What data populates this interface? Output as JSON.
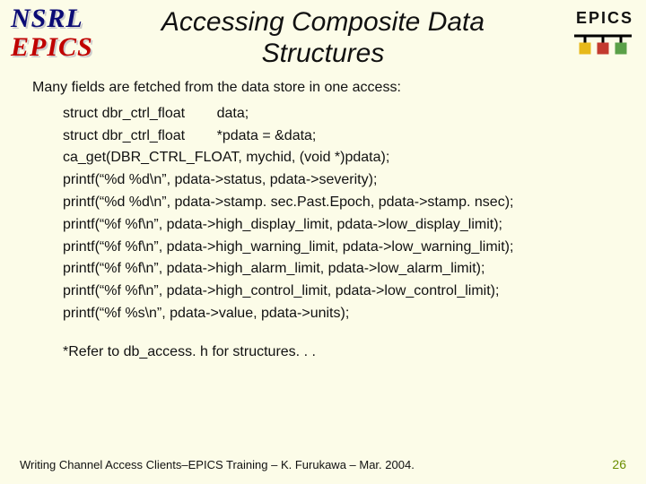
{
  "logos": {
    "nsrl": "NSRL",
    "epics_left": "EPICS",
    "epics_right": "EPICS"
  },
  "title": "Accessing Composite Data Structures",
  "intro": "Many fields are fetched from the data store in one access:",
  "code_lines": [
    "struct dbr_ctrl_float        data;",
    "struct dbr_ctrl_float        *pdata = &data;",
    "ca_get(DBR_CTRL_FLOAT, mychid, (void *)pdata);",
    "printf(“%d %d\\n”, pdata->status, pdata->severity);",
    "printf(“%d %d\\n”, pdata->stamp. sec.Past.Epoch, pdata->stamp. nsec);",
    "printf(“%f %f\\n”, pdata->high_display_limit, pdata->low_display_limit);",
    "printf(“%f %f\\n”, pdata->high_warning_limit, pdata->low_warning_limit);",
    "printf(“%f %f\\n”, pdata->high_alarm_limit, pdata->low_alarm_limit);",
    "printf(“%f %f\\n”, pdata->high_control_limit, pdata->low_control_limit);",
    "printf(“%f %s\\n”, pdata->value, pdata->units);"
  ],
  "note": "*Refer to db_access. h for structures. . .",
  "footer": "Writing Channel Access Clients–EPICS Training – K. Furukawa – Mar. 2004.",
  "pagenum": "26",
  "logo_colors": {
    "top_line": "#000000",
    "box1": "#e7b91a",
    "box2": "#c33a2f",
    "box3": "#5aa048"
  }
}
